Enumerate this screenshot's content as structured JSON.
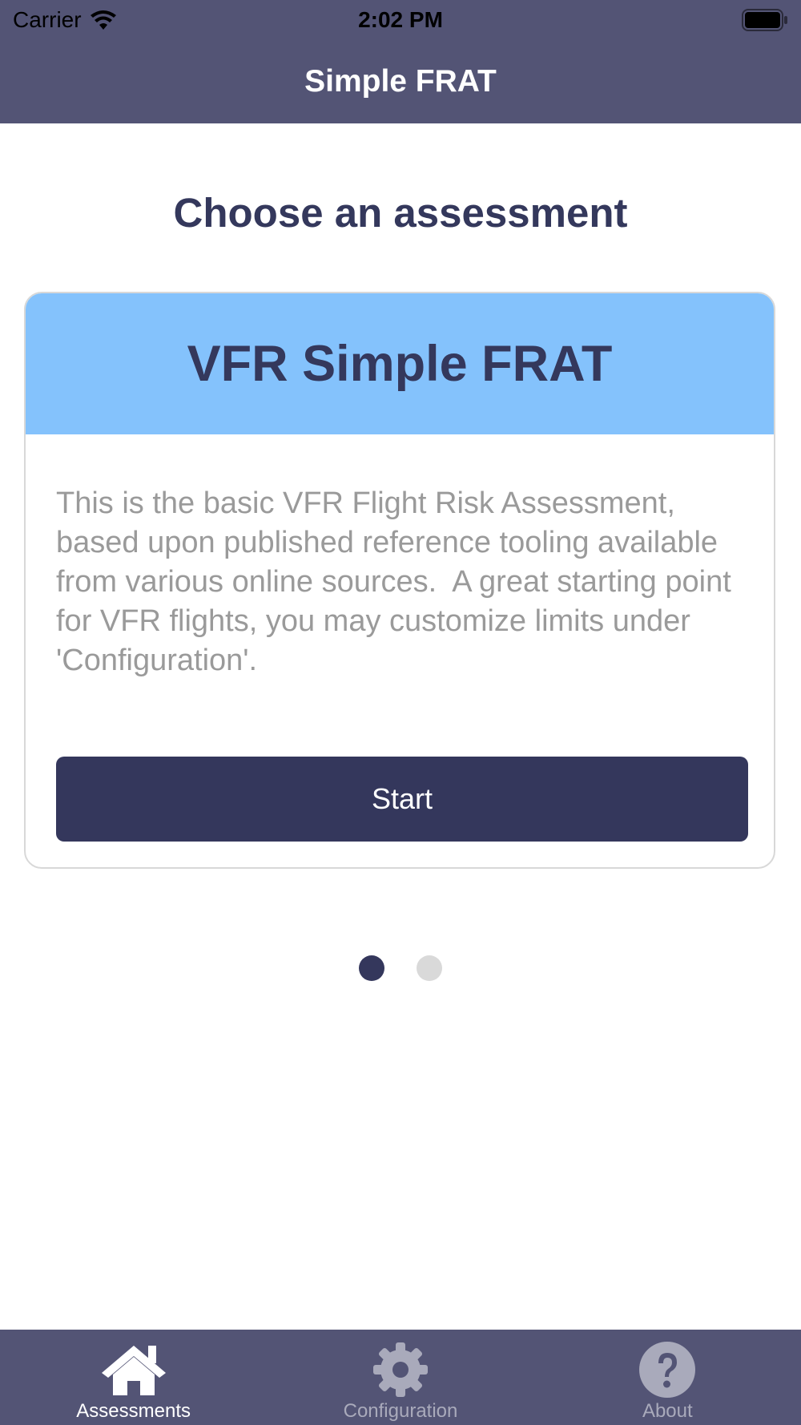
{
  "status_bar": {
    "carrier": "Carrier",
    "time": "2:02 PM"
  },
  "nav": {
    "title": "Simple FRAT"
  },
  "main": {
    "heading": "Choose an assessment",
    "card": {
      "title": "VFR Simple FRAT",
      "description": "This is the basic VFR Flight Risk Assessment, based upon published reference tooling available from various online sources.  A great starting point for VFR flights, you may customize limits under 'Configuration'.",
      "button_label": "Start"
    },
    "pager": {
      "page_count": 2,
      "current_page": 1
    }
  },
  "tabbar": {
    "tabs": [
      {
        "label": "Assessments",
        "icon": "house-icon",
        "selected": true
      },
      {
        "label": "Configuration",
        "icon": "gear-icon",
        "selected": false
      },
      {
        "label": "About",
        "icon": "question-circle-icon",
        "selected": false
      }
    ]
  },
  "colors": {
    "header_bg": "#535475",
    "card_header_bg": "#84c2fc",
    "primary_dark": "#34375c",
    "tab_selected": "#ffffff",
    "tab_unselected": "#a9aabb",
    "dot_active": "#34375c",
    "dot_inactive": "#d9d9d9"
  }
}
